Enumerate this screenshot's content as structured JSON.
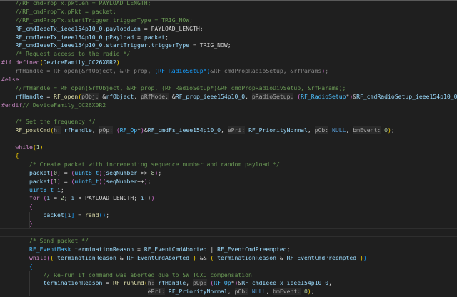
{
  "colors": {
    "background": "#1f1f1f",
    "comment": "#6a9955",
    "variable": "#9cdcfe",
    "function": "#dcdcaa",
    "keyword": "#c586c0",
    "number": "#b5cea8",
    "bracket1": "#ffd700",
    "bracket2": "#da70d6",
    "bracket3": "#179fff"
  },
  "code": {
    "lines": [
      [
        [
          "    //RF_cmdPropTx.pktLen = PAYLOAD_LENGTH;",
          "cm"
        ]
      ],
      [
        [
          "    //RF_cmdPropTx.pPkt = packet;",
          "cm"
        ]
      ],
      [
        [
          "    //RF_cmdPropTx.startTrigger.triggerType = TRIG_NOW;",
          "cm"
        ]
      ],
      [
        [
          "    ",
          "p"
        ],
        [
          "RF_cmdIeeeTx_ieee154p10_0",
          "v"
        ],
        [
          ".",
          "p"
        ],
        [
          "payloadLen",
          "v"
        ],
        [
          " = ",
          "p"
        ],
        [
          "PAYLOAD_LENGTH",
          "c"
        ],
        [
          ";",
          "p"
        ]
      ],
      [
        [
          "    ",
          "p"
        ],
        [
          "RF_cmdIeeeTx_ieee154p10_0",
          "v"
        ],
        [
          ".",
          "p"
        ],
        [
          "pPayload",
          "v"
        ],
        [
          " = ",
          "p"
        ],
        [
          "packet",
          "v"
        ],
        [
          ";",
          "p"
        ]
      ],
      [
        [
          "    ",
          "p"
        ],
        [
          "RF_cmdIeeeTx_ieee154p10_0",
          "v"
        ],
        [
          ".",
          "p"
        ],
        [
          "startTrigger",
          "v"
        ],
        [
          ".",
          "p"
        ],
        [
          "triggerType",
          "v"
        ],
        [
          " = ",
          "p"
        ],
        [
          "TRIG_NOW",
          "c"
        ],
        [
          ";",
          "p"
        ]
      ],
      [
        [
          "    /* Request access to the radio */",
          "cm"
        ]
      ],
      [
        [
          "#if ",
          "k"
        ],
        [
          "defined",
          "k"
        ],
        [
          "(",
          "b1"
        ],
        [
          "DeviceFamily_CC26X0R2",
          "v"
        ],
        [
          ")",
          "b1"
        ]
      ],
      [
        [
          "    rfHandle = RF_open(&rfObject, &RF_prop, ",
          "dim"
        ],
        [
          "(RF_RadioSetup*)",
          "b3"
        ],
        [
          "&RF_cmdPropRadioSetup, &rfParams",
          "dim"
        ],
        [
          ")",
          "b2"
        ],
        [
          ";",
          "dim"
        ]
      ],
      [
        [
          "#else",
          "k"
        ]
      ],
      [
        [
          "    //rfHandle = RF_open(&rfObject, &RF_prop, (RF_RadioSetup*)&RF_cmdPropRadioDivSetup, &rfParams);",
          "cm"
        ]
      ],
      [
        [
          "    ",
          "p"
        ],
        [
          "rfHandle",
          "v"
        ],
        [
          " = ",
          "p"
        ],
        [
          "RF_open",
          "f"
        ],
        [
          "(",
          "b1"
        ],
        [
          "pObj:",
          "h"
        ],
        [
          " &",
          "p"
        ],
        [
          "rfObject",
          "v"
        ],
        [
          ", ",
          "p"
        ],
        [
          "pRfMode:",
          "h"
        ],
        [
          " &",
          "p"
        ],
        [
          "RF_prop_ieee154p10_0",
          "v"
        ],
        [
          ", ",
          "p"
        ],
        [
          "pRadioSetup:",
          "h"
        ],
        [
          " ",
          "p"
        ],
        [
          "(",
          "b2"
        ],
        [
          "RF_RadioSetup",
          "t"
        ],
        [
          "*",
          "p"
        ],
        [
          ")",
          "b2"
        ],
        [
          "&",
          "p"
        ],
        [
          "RF_cmdRadioSetup_ieee154p10_0",
          "v"
        ]
      ],
      [
        [
          "#endif",
          "k"
        ],
        [
          "// DeviceFamily_CC26X0R2",
          "cm"
        ]
      ],
      [],
      [
        [
          "    /* Set the frequency */",
          "cm"
        ]
      ],
      [
        [
          "    ",
          "p"
        ],
        [
          "RF_postCmd",
          "f"
        ],
        [
          "(",
          "b1"
        ],
        [
          "h:",
          "h"
        ],
        [
          " ",
          "p"
        ],
        [
          "rfHandle",
          "v"
        ],
        [
          ", ",
          "p"
        ],
        [
          "pOp:",
          "h"
        ],
        [
          " ",
          "p"
        ],
        [
          "(",
          "b2"
        ],
        [
          "RF_Op",
          "t"
        ],
        [
          "*",
          "p"
        ],
        [
          ")",
          "b2"
        ],
        [
          "&",
          "p"
        ],
        [
          "RF_cmdFs_ieee154p10_0",
          "v"
        ],
        [
          ", ",
          "p"
        ],
        [
          "ePri:",
          "h"
        ],
        [
          " ",
          "p"
        ],
        [
          "RF_PriorityNormal",
          "v"
        ],
        [
          ", ",
          "p"
        ],
        [
          "pCb:",
          "h"
        ],
        [
          " ",
          "p"
        ],
        [
          "NULL",
          "kw"
        ],
        [
          ", ",
          "p"
        ],
        [
          "bmEvent:",
          "h"
        ],
        [
          " ",
          "p"
        ],
        [
          "0",
          "n"
        ],
        [
          ")",
          "b1"
        ],
        [
          ";",
          "p"
        ]
      ],
      [],
      [
        [
          "    ",
          "p"
        ],
        [
          "while",
          "k"
        ],
        [
          "(",
          "b1"
        ],
        [
          "1",
          "n"
        ],
        [
          ")",
          "b1"
        ]
      ],
      [
        [
          "    ",
          "p"
        ],
        [
          "{",
          "b1"
        ]
      ],
      [
        [
          "        /* Create packet with incrementing sequence number and random payload */",
          "cm"
        ]
      ],
      [
        [
          "        ",
          "p"
        ],
        [
          "packet",
          "v"
        ],
        [
          "[",
          "b2"
        ],
        [
          "0",
          "n"
        ],
        [
          "]",
          "b2"
        ],
        [
          " = ",
          "p"
        ],
        [
          "(",
          "b2"
        ],
        [
          "uint8_t",
          "t"
        ],
        [
          ")",
          "b2"
        ],
        [
          "(",
          "b2"
        ],
        [
          "seqNumber",
          "v"
        ],
        [
          " >> ",
          "p"
        ],
        [
          "8",
          "n"
        ],
        [
          ")",
          "b2"
        ],
        [
          ";",
          "p"
        ]
      ],
      [
        [
          "        ",
          "p"
        ],
        [
          "packet",
          "v"
        ],
        [
          "[",
          "b2"
        ],
        [
          "1",
          "n"
        ],
        [
          "]",
          "b2"
        ],
        [
          " = ",
          "p"
        ],
        [
          "(",
          "b2"
        ],
        [
          "uint8_t",
          "t"
        ],
        [
          ")",
          "b2"
        ],
        [
          "(",
          "b2"
        ],
        [
          "seqNumber",
          "v"
        ],
        [
          "++",
          "p"
        ],
        [
          ")",
          "b2"
        ],
        [
          ";",
          "p"
        ]
      ],
      [
        [
          "        ",
          "p"
        ],
        [
          "uint8_t",
          "t"
        ],
        [
          " ",
          "p"
        ],
        [
          "i",
          "v"
        ],
        [
          ";",
          "p"
        ]
      ],
      [
        [
          "        ",
          "p"
        ],
        [
          "for",
          "k"
        ],
        [
          " ",
          "p"
        ],
        [
          "(",
          "b2"
        ],
        [
          "i",
          "v"
        ],
        [
          " = ",
          "p"
        ],
        [
          "2",
          "n"
        ],
        [
          "; ",
          "p"
        ],
        [
          "i",
          "v"
        ],
        [
          " < ",
          "p"
        ],
        [
          "PAYLOAD_LENGTH",
          "c"
        ],
        [
          "; ",
          "p"
        ],
        [
          "i",
          "v"
        ],
        [
          "++",
          "p"
        ],
        [
          ")",
          "b2"
        ]
      ],
      [
        [
          "        ",
          "p"
        ],
        [
          "{",
          "b2"
        ]
      ],
      [
        [
          "            ",
          "p"
        ],
        [
          "packet",
          "v"
        ],
        [
          "[",
          "b3"
        ],
        [
          "i",
          "v"
        ],
        [
          "]",
          "b3"
        ],
        [
          " = ",
          "p"
        ],
        [
          "rand",
          "f"
        ],
        [
          "()",
          "b3"
        ],
        [
          ";",
          "p"
        ]
      ],
      [
        [
          "        ",
          "p"
        ],
        [
          "}",
          "b2"
        ]
      ],
      [],
      [
        [
          "        /* Send packet */",
          "cm"
        ]
      ],
      [
        [
          "        ",
          "p"
        ],
        [
          "RF_EventMask",
          "t"
        ],
        [
          " ",
          "p"
        ],
        [
          "terminationReason",
          "v"
        ],
        [
          " = ",
          "p"
        ],
        [
          "RF_EventCmdAborted",
          "v"
        ],
        [
          " | ",
          "p"
        ],
        [
          "RF_EventCmdPreempted",
          "v"
        ],
        [
          ";",
          "p"
        ]
      ],
      [
        [
          "        ",
          "p"
        ],
        [
          "while",
          "k"
        ],
        [
          "(",
          "b2"
        ],
        [
          "(",
          "b1"
        ],
        [
          " ",
          "p"
        ],
        [
          "terminationReason",
          "v"
        ],
        [
          " & ",
          "p"
        ],
        [
          "RF_EventCmdAborted",
          "v"
        ],
        [
          " ",
          "p"
        ],
        [
          ")",
          "b1"
        ],
        [
          " && ",
          "p"
        ],
        [
          "(",
          "b1"
        ],
        [
          " ",
          "p"
        ],
        [
          "terminationReason",
          "v"
        ],
        [
          " & ",
          "p"
        ],
        [
          "RF_EventCmdPreempted",
          "v"
        ],
        [
          " ",
          "p"
        ],
        [
          ")",
          "b1"
        ],
        [
          ")",
          "b3"
        ]
      ],
      [
        [
          "        ",
          "p"
        ],
        [
          "{",
          "b3"
        ]
      ],
      [
        [
          "            // Re-run if command was aborted due to SW TCXO compensation",
          "cm"
        ]
      ],
      [
        [
          "            ",
          "p"
        ],
        [
          "terminationReason",
          "v"
        ],
        [
          " = ",
          "p"
        ],
        [
          "RF_runCmd",
          "f"
        ],
        [
          "(",
          "b1"
        ],
        [
          "h:",
          "h"
        ],
        [
          " ",
          "p"
        ],
        [
          "rfHandle",
          "v"
        ],
        [
          ", ",
          "p"
        ],
        [
          "pOp:",
          "h"
        ],
        [
          " ",
          "p"
        ],
        [
          "(",
          "b2"
        ],
        [
          "RF_Op",
          "t"
        ],
        [
          "*",
          "p"
        ],
        [
          ")",
          "b2"
        ],
        [
          "&",
          "p"
        ],
        [
          "RF_cmdIeeeTx_ieee154p10_0",
          "v"
        ],
        [
          ",",
          "p"
        ]
      ],
      [
        [
          "                                          ",
          "p"
        ],
        [
          "ePri:",
          "h"
        ],
        [
          " ",
          "p"
        ],
        [
          "RF_PriorityNormal",
          "v"
        ],
        [
          ", ",
          "p"
        ],
        [
          "pCb:",
          "h"
        ],
        [
          " ",
          "p"
        ],
        [
          "NULL",
          "kw"
        ],
        [
          ", ",
          "p"
        ],
        [
          "bmEvent:",
          "h"
        ],
        [
          " ",
          "p"
        ],
        [
          "0",
          "n"
        ],
        [
          ")",
          "b1"
        ],
        [
          ";",
          "p"
        ]
      ]
    ],
    "current_line": 27
  }
}
